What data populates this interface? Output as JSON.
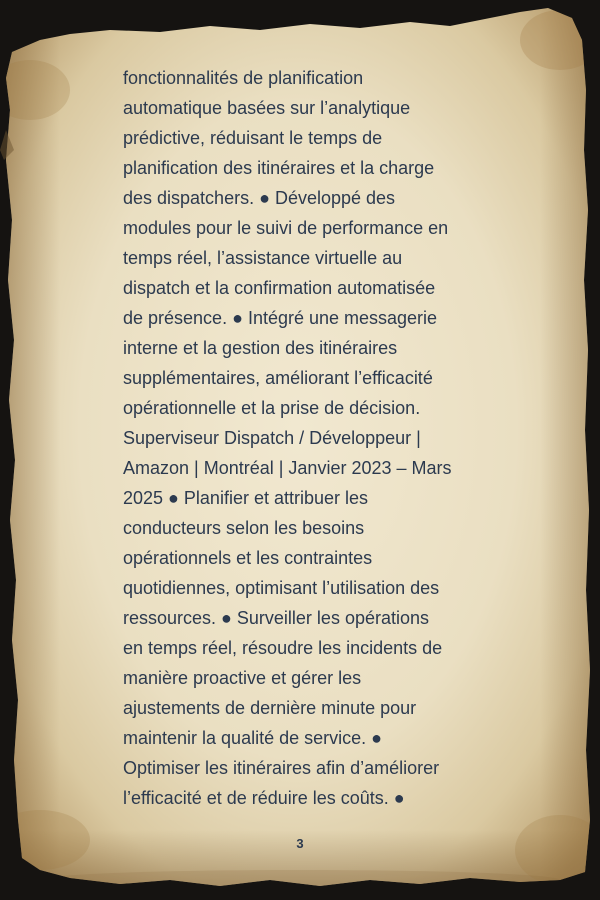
{
  "document": {
    "lines": [
      "fonctionnalités de planification",
      "automatique basées sur l’analytique",
      "prédictive, réduisant le temps de",
      "planification des itinéraires et la charge",
      "des dispatchers. ● Développé des",
      "modules pour le suivi de performance en",
      "temps réel, l’assistance virtuelle au",
      "dispatch et la confirmation automatisée",
      "de présence. ● Intégré une messagerie",
      "interne et la gestion des itinéraires",
      "supplémentaires, améliorant l’efficacité",
      "opérationnelle et la prise de décision.",
      "Superviseur Dispatch / Développeur |",
      "Amazon | Montréal | Janvier 2023 – Mars",
      "2025 ● Planifier et attribuer les",
      "conducteurs selon les besoins",
      "opérationnels et les contraintes",
      "quotidiennes, optimisant l’utilisation des",
      "ressources. ● Surveiller les opérations",
      "en temps réel, résoudre les incidents de",
      "manière proactive et gérer les",
      "ajustements de dernière minute pour",
      "maintenir la qualité de service. ●",
      "Optimiser les itinéraires afin d’améliorer",
      "l’efficacité et de réduire les coûts. ●"
    ],
    "page_number": "3"
  },
  "colors": {
    "text": "#2c3a4f",
    "parchment": "#e8dcc0",
    "background": "#151311"
  }
}
